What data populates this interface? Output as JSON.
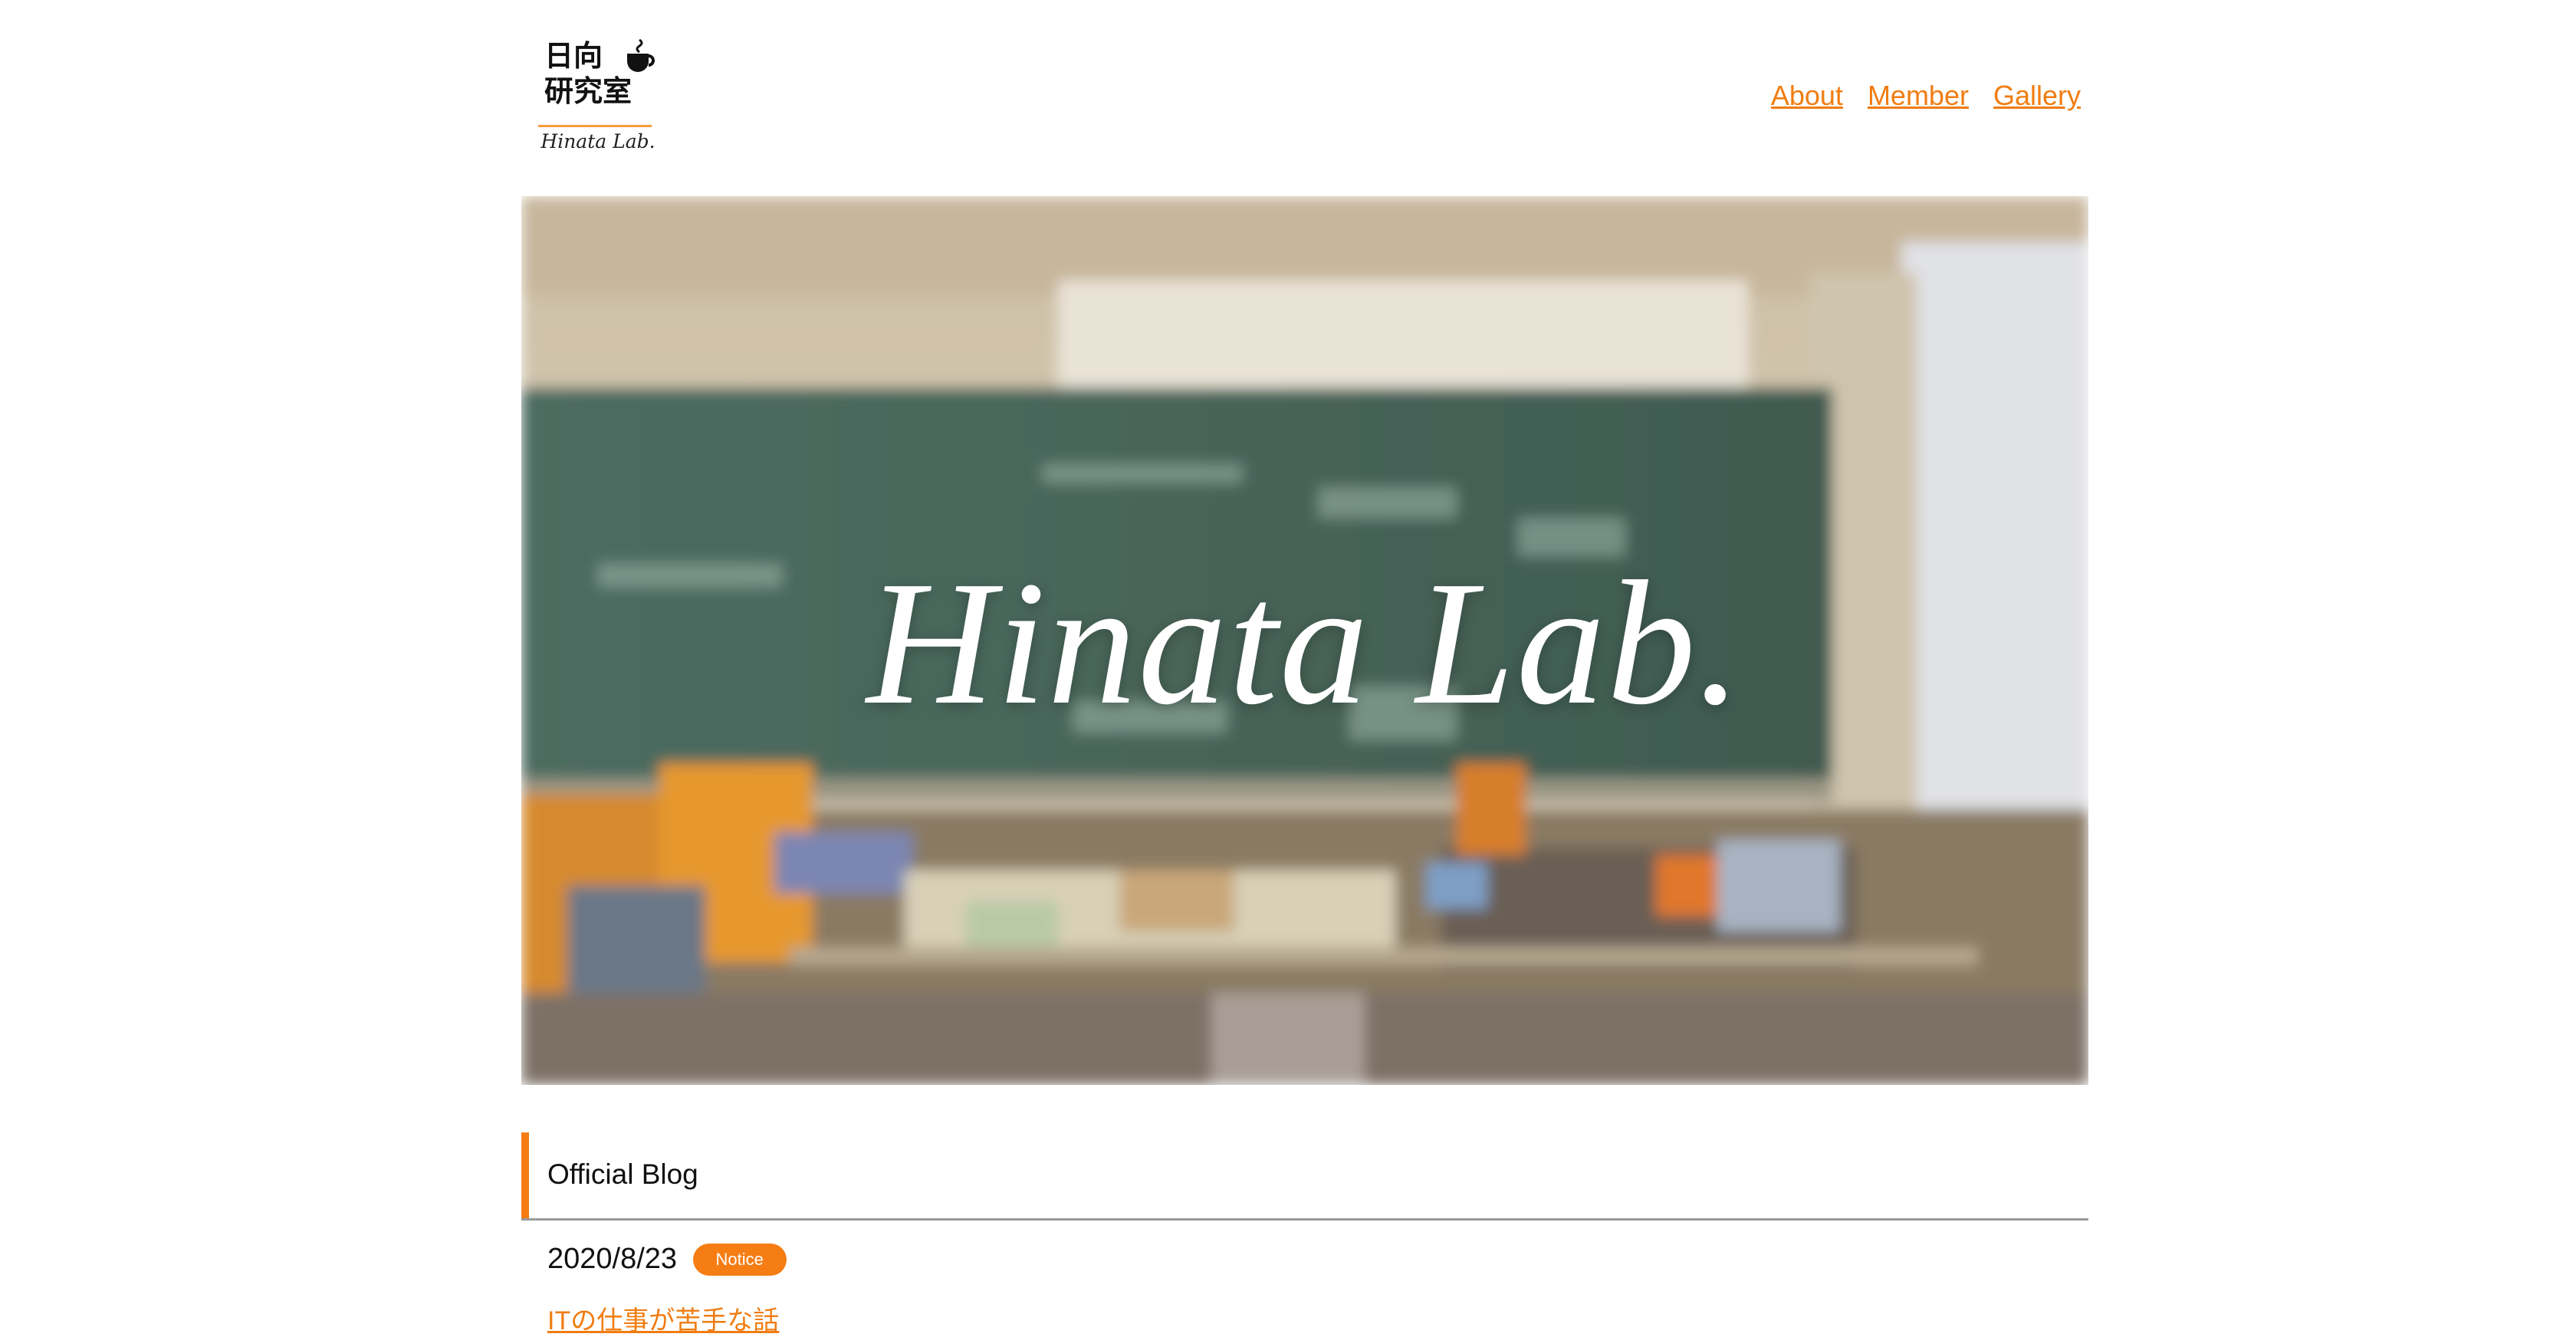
{
  "logo": {
    "kanji_line1": "日向",
    "kanji_line2": "研究室",
    "latin": "Hinata Lab.",
    "icon": "coffee-cup-icon",
    "rule_color": "#f59a3c"
  },
  "nav": {
    "items": [
      {
        "label": "About"
      },
      {
        "label": "Member"
      },
      {
        "label": "Gallery"
      }
    ],
    "color": "#f07d12"
  },
  "hero": {
    "title": "Hinata Lab."
  },
  "blog": {
    "heading": "Official Blog",
    "accent": "#f57d14",
    "posts": [
      {
        "date": "2020/8/23",
        "tag": "Notice",
        "title": "ITの仕事が苦手な話"
      }
    ]
  }
}
